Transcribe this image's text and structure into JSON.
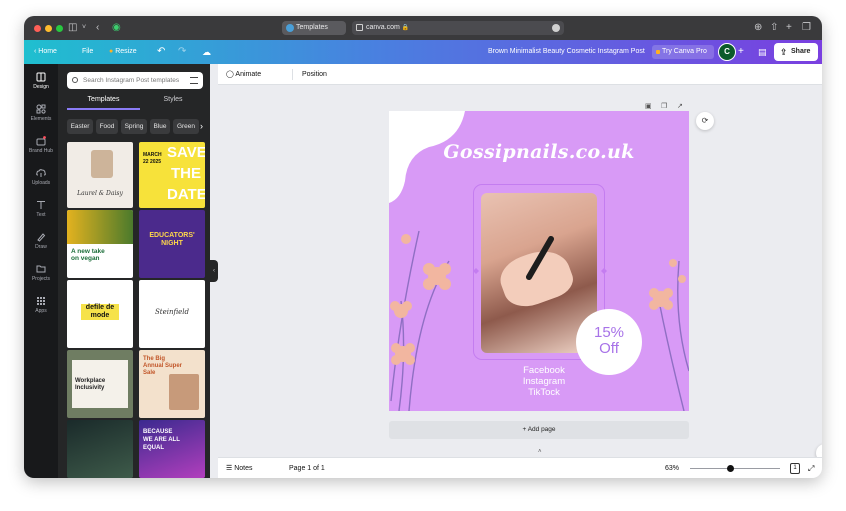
{
  "browser": {
    "tab_title": "Templates",
    "url": "canva.com"
  },
  "topbar": {
    "home": "Home",
    "file": "File",
    "resize": "Resize",
    "doc_title": "Brown Minimalist Beauty Cosmetic Instagram Post",
    "try_pro": "Try Canva Pro",
    "avatar_initial": "C",
    "share": "Share"
  },
  "rail": {
    "items": [
      {
        "label": "Design",
        "icon": "layout-icon"
      },
      {
        "label": "Elements",
        "icon": "shapes-icon"
      },
      {
        "label": "Brand Hub",
        "icon": "brand-icon"
      },
      {
        "label": "Uploads",
        "icon": "cloud-upload-icon"
      },
      {
        "label": "Text",
        "icon": "text-icon"
      },
      {
        "label": "Draw",
        "icon": "draw-icon"
      },
      {
        "label": "Projects",
        "icon": "folder-icon"
      },
      {
        "label": "Apps",
        "icon": "apps-grid-icon"
      }
    ]
  },
  "panel": {
    "search_placeholder": "Search Instagram Post templates",
    "tabs": [
      "Templates",
      "Styles"
    ],
    "chips": [
      "Easter",
      "Food",
      "Spring",
      "Blue",
      "Green"
    ],
    "thumbs": {
      "t1": "Laurel & Daisy",
      "t2": "MARCH 22 2025",
      "t2_big": "SAVE THE DATE",
      "t3": "A new take on vegan",
      "t4": "EDUCATORS' NIGHT",
      "t5": "defile de mode",
      "t6": "Steinfield",
      "t7": "The Big Annual Super Sale",
      "t8": "Workplace Inclusivity",
      "t10": "BECAUSE WE ARE ALL EQUAL"
    }
  },
  "editor": {
    "animate": "Animate",
    "position": "Position",
    "design": {
      "title": "Gossipnails.co.uk",
      "badge_line1": "15%",
      "badge_line2": "Off",
      "social": [
        "Facebook",
        "Instagram",
        "TikTock"
      ],
      "bg_color": "#d89af6"
    },
    "add_page": "+ Add page",
    "notes": "Notes",
    "page_indicator": "Page 1 of 1",
    "zoom": "63%",
    "zoom_fraction": 0.44,
    "page_count_badge": "1"
  }
}
